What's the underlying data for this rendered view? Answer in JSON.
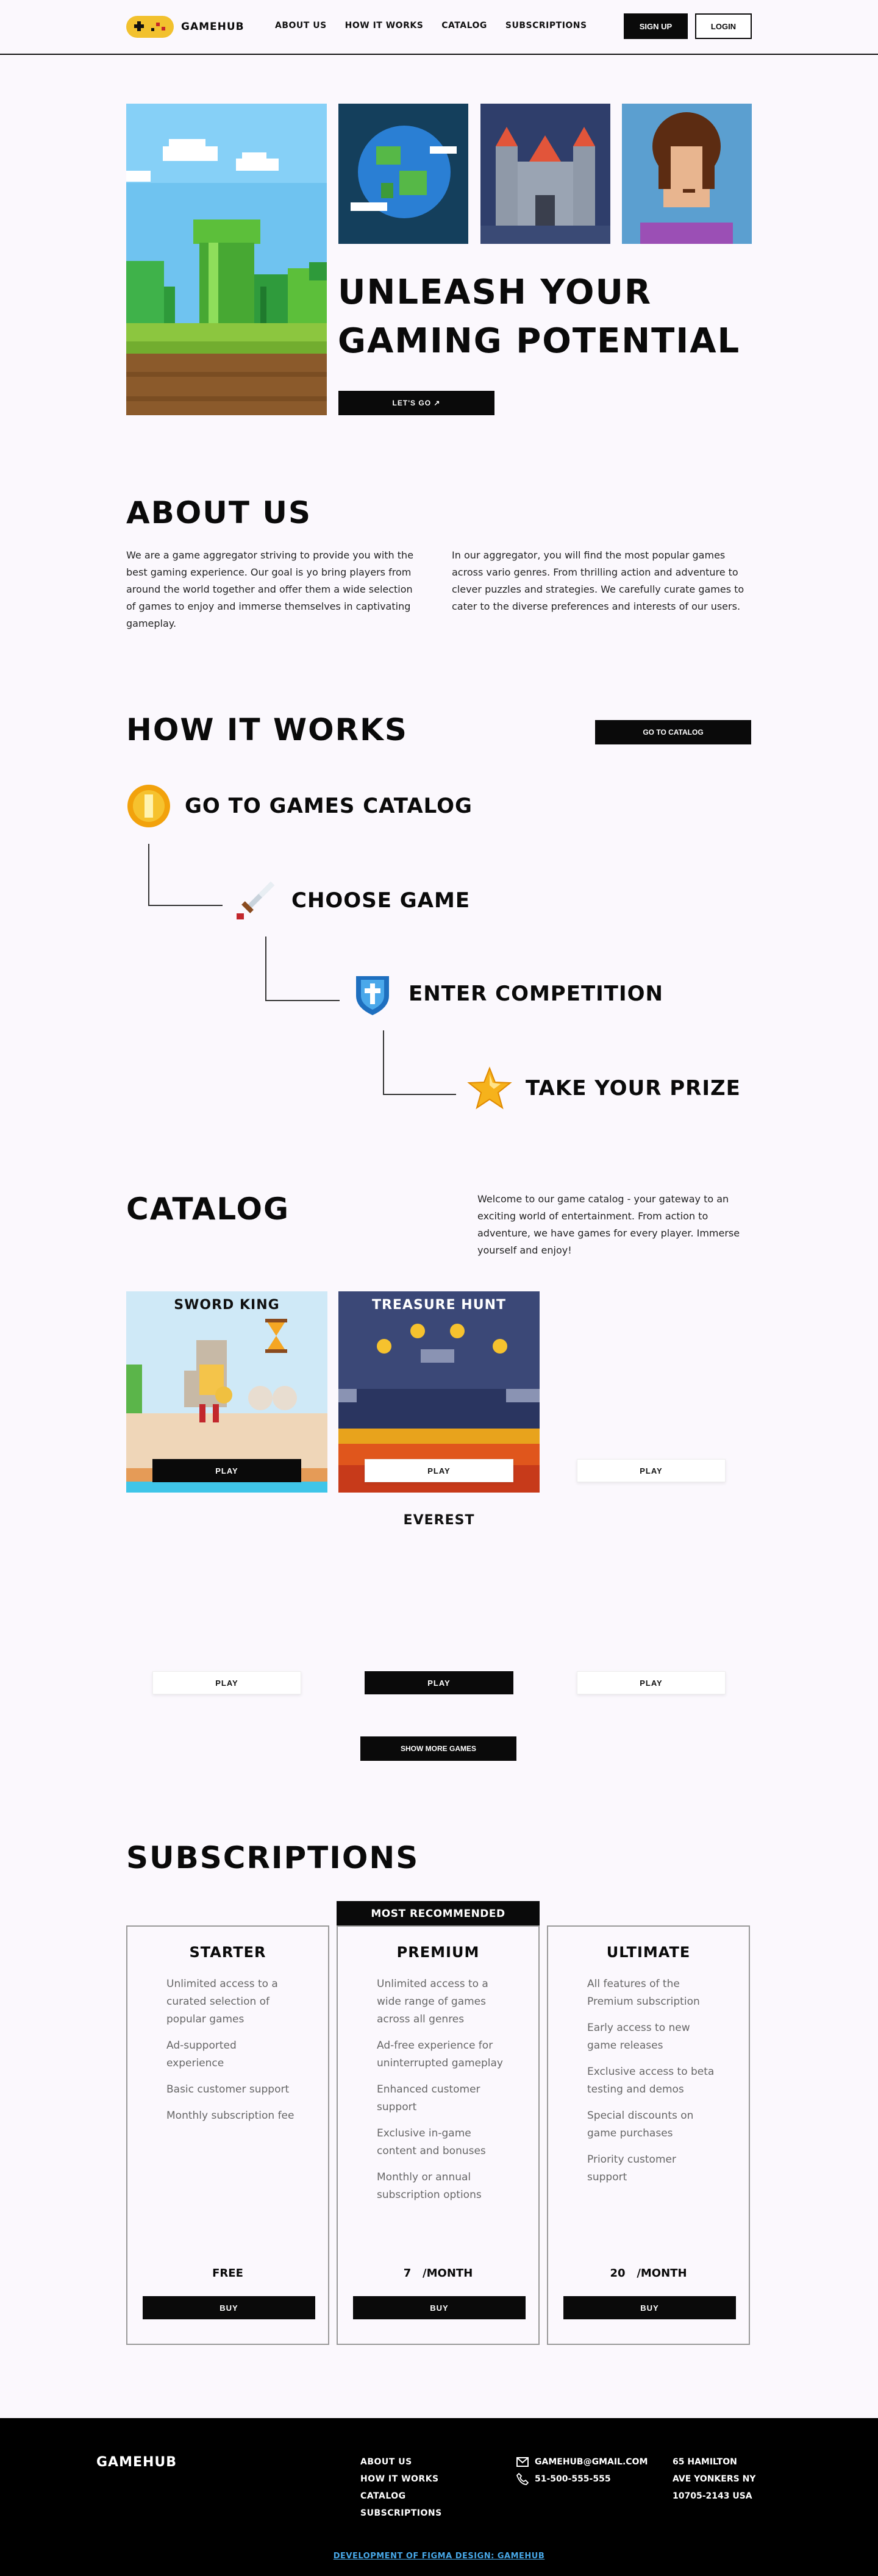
{
  "header": {
    "logo_text": "GAMEHUB",
    "nav": [
      "ABOUT US",
      "HOW IT WORKS",
      "CATALOG",
      "SUBSCRIPTIONS"
    ],
    "signup_label": "SIGN UP",
    "login_label": "LOGIN"
  },
  "hero": {
    "title_line1": "UNLEASH YOUR",
    "title_line2": "GAMING POTENTIAL",
    "cta_label": "LET'S GO ↗"
  },
  "about": {
    "title": "ABOUT US",
    "paragraph_left": "We are a game aggregator striving to provide you with the best gaming experience. Our goal is yo bring players from around the world together and offer them a wide selection of games to enjoy and immerse themselves in captivating gameplay.",
    "paragraph_right": "In our aggregator, you will find the most popular games across vario genres. From thrilling action and adventure to clever puzzles and strategies. We carefully curate games to cater to the diverse preferences and interests of our users."
  },
  "how": {
    "title": "HOW IT WORKS",
    "catalog_button": "GO TO CATALOG",
    "steps": [
      {
        "label": "GO TO GAMES CATALOG",
        "icon": "coin-icon"
      },
      {
        "label": "CHOOSE GAME",
        "icon": "sword-icon"
      },
      {
        "label": "ENTER COMPETITION",
        "icon": "shield-icon"
      },
      {
        "label": "TAKE YOUR PRIZE",
        "icon": "star-icon"
      }
    ]
  },
  "catalog": {
    "title": "CATALOG",
    "intro": "Welcome to our game catalog - your gateway to an exciting world of entertainment. From action to adventure, we have games for every player. Immerse yourself and enjoy!",
    "games": [
      {
        "title": "SWORD KING",
        "play_label": "PLAY"
      },
      {
        "title": "TREASURE HUNT",
        "play_label": "PLAY"
      },
      {
        "title": "",
        "play_label": "PLAY"
      },
      {
        "title": "EVEREST",
        "play_label": "PLAY"
      },
      {
        "title": "",
        "play_label": "PLAY"
      },
      {
        "title": "",
        "play_label": "PLAY"
      }
    ],
    "show_more": "SHOW MORE GAMES"
  },
  "subscriptions": {
    "title": "SUBSCRIPTIONS",
    "recommended_badge": "MOST RECOMMENDED",
    "plans": [
      {
        "name": "STARTER",
        "features": [
          "Unlimited access to a curated selection of popular games",
          "Ad-supported experience",
          "Basic customer support",
          "Monthly subscription fee"
        ],
        "price": "FREE",
        "buy_label": "BUY"
      },
      {
        "name": "PREMIUM",
        "features": [
          "Unlimited access to a wide range of games across all genres",
          "Ad-free experience for uninterrupted gameplay",
          "Enhanced customer support",
          "Exclusive in-game content and bonuses",
          "Monthly or annual subscription options"
        ],
        "price": "7   /MONTH",
        "buy_label": "BUY"
      },
      {
        "name": "ULTIMATE",
        "features": [
          "All features of the Premium subscription",
          "Early access to new game releases",
          "Exclusive access to beta testing and demos",
          "Special discounts on game purchases",
          "Priority customer support"
        ],
        "price": "20   /MONTH",
        "buy_label": "BUY"
      }
    ]
  },
  "footer": {
    "logo_text": "GAMEHUB",
    "nav": [
      "ABOUT US",
      "HOW IT WORKS",
      "CATALOG",
      "SUBSCRIPTIONS"
    ],
    "email": "GAMEHUB@GMAIL.COM",
    "phone": "51-500-555-555",
    "address_line1": "65 HAMILTON",
    "address_line2": "AVE YONKERS NY",
    "address_line3": "10705-2143 USA",
    "credit": "DEVELOPMENT OF FIGMA DESIGN: GAMEHUB"
  },
  "colors": {
    "background": "#fbf8fd",
    "primary": "#0a0a0a",
    "footer_link": "#48a8e8"
  }
}
